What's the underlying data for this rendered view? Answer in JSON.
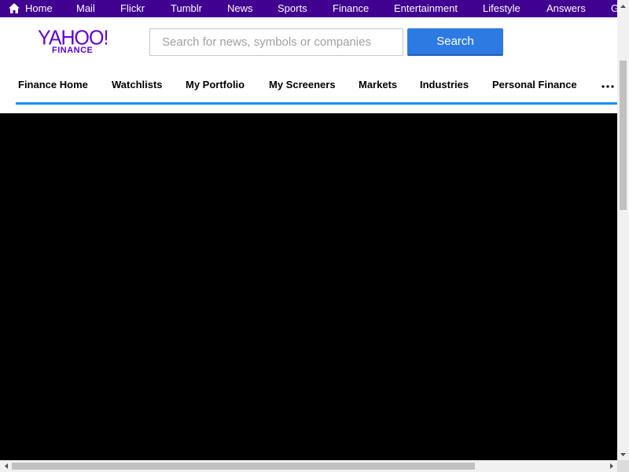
{
  "topbar": {
    "items": [
      {
        "label": "Home",
        "icon": "home-icon"
      },
      {
        "label": "Mail"
      },
      {
        "label": "Flickr"
      },
      {
        "label": "Tumblr"
      },
      {
        "label": "News"
      },
      {
        "label": "Sports"
      },
      {
        "label": "Finance"
      },
      {
        "label": "Entertainment"
      },
      {
        "label": "Lifestyle"
      },
      {
        "label": "Answers"
      },
      {
        "label": "G"
      }
    ],
    "background": "#400090"
  },
  "logo": {
    "brand": "YAHOO!",
    "product": "FINANCE",
    "color": "#6001d2"
  },
  "search": {
    "placeholder": "Search for news, symbols or companies",
    "value": "",
    "button_label": "Search",
    "button_color": "#2d7ae3"
  },
  "finance_nav": {
    "items": [
      {
        "label": "Finance Home"
      },
      {
        "label": "Watchlists"
      },
      {
        "label": "My Portfolio"
      },
      {
        "label": "My Screeners"
      },
      {
        "label": "Markets"
      },
      {
        "label": "Industries"
      },
      {
        "label": "Personal Finance"
      }
    ],
    "more_icon": "ellipsis-icon",
    "underline_color": "#188fff"
  }
}
